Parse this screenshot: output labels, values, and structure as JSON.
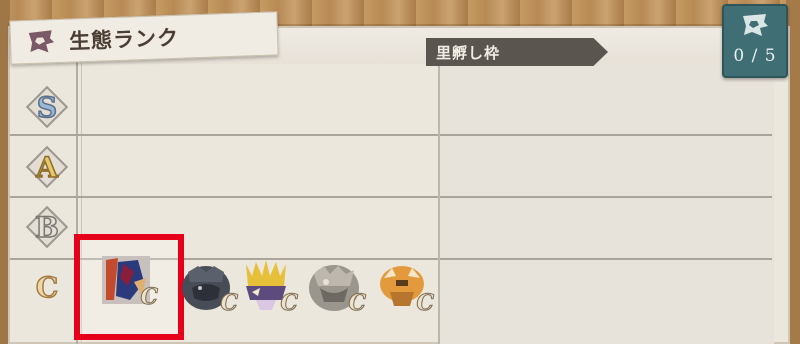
{
  "title": {
    "text": "生態ランク",
    "icon": "rank-emblem-icon"
  },
  "ranks": [
    {
      "letter": "S"
    },
    {
      "letter": "A"
    },
    {
      "letter": "B"
    },
    {
      "letter": "C"
    }
  ],
  "slot_panel": {
    "header": "里孵し枠"
  },
  "counter": {
    "value": "0 / 5",
    "icon": "rank-emblem-icon"
  },
  "monsters": [
    {
      "name": "monster-1",
      "rank": "C",
      "selected": true
    },
    {
      "name": "monster-2",
      "rank": "C",
      "selected": false
    },
    {
      "name": "monster-3",
      "rank": "C",
      "selected": false
    },
    {
      "name": "monster-4",
      "rank": "C",
      "selected": false
    },
    {
      "name": "monster-5",
      "rank": "C",
      "selected": false
    }
  ],
  "colors": {
    "selection_border": "#e6001a",
    "counter_bg": "#3f6f74",
    "panel_bg": "#ece7dd"
  }
}
